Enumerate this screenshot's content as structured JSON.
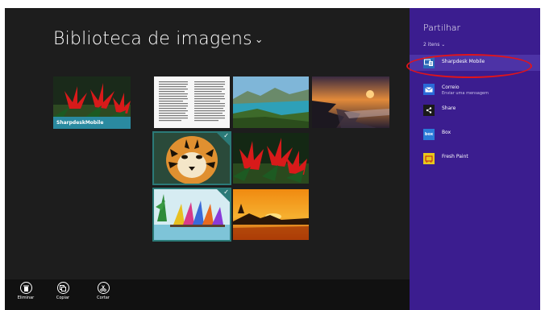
{
  "library": {
    "title": "Biblioteca de imagens",
    "chevron": "⌄",
    "folder_label": "SharpdeskMobile"
  },
  "appbar": {
    "delete_label": "Eliminar",
    "copy_label": "Copiar",
    "cut_label": "Cortar"
  },
  "share": {
    "title": "Partilhar",
    "items_count": "2 itens ⌄",
    "apps": [
      {
        "name": "Sharpdesk Mobile",
        "sub": ""
      },
      {
        "name": "Correio",
        "sub": "Enviar uma mensagem"
      },
      {
        "name": "Share",
        "sub": ""
      },
      {
        "name": "Box",
        "sub": ""
      },
      {
        "name": "Fresh Paint",
        "sub": ""
      }
    ],
    "box_icon_text": "box"
  },
  "check_mark": "✓",
  "colors": {
    "share_bg": "#3b1d8f",
    "highlight_bg": "#4d33a6",
    "selection": "#2b7a78",
    "annotation": "#e0141b"
  }
}
